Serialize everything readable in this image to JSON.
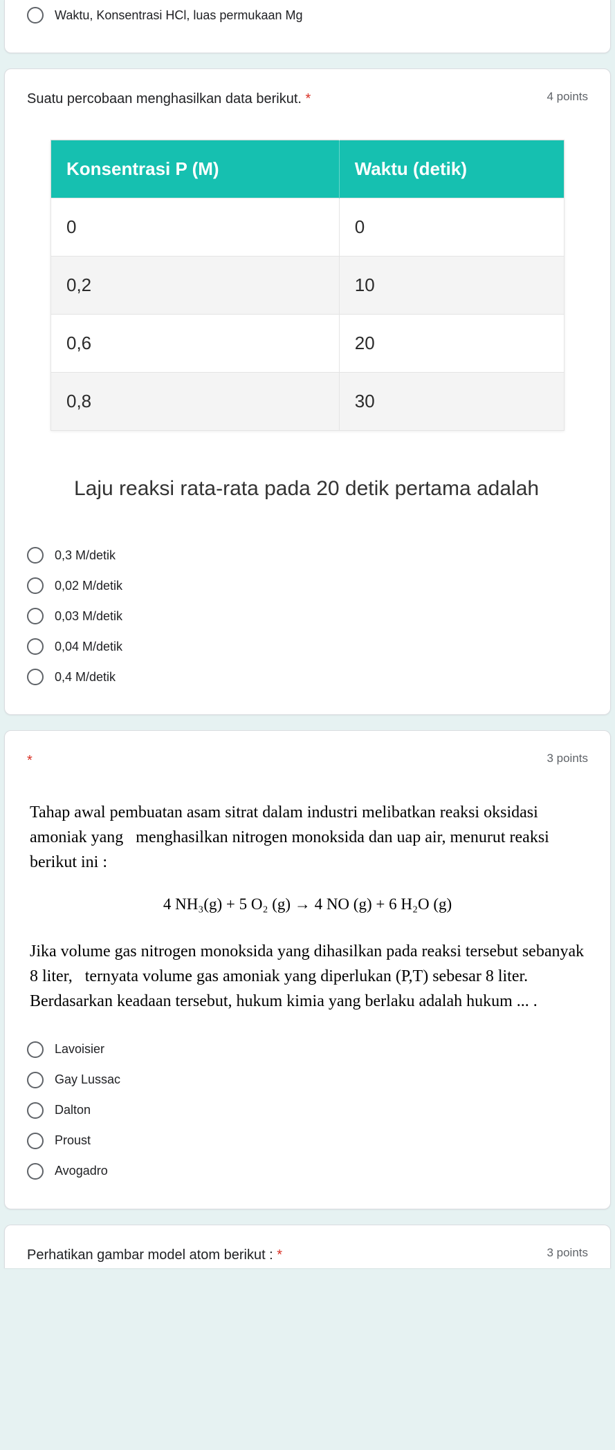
{
  "q1": {
    "opt_last": "Waktu, Konsentrasi HCl, luas permukaan Mg"
  },
  "q2": {
    "title": "Suatu percobaan menghasilkan data berikut.",
    "points": "4 points",
    "th1": "Konsentrasi P (M)",
    "th2": "Waktu (detik)",
    "rows": [
      {
        "c1": "0",
        "c2": "0"
      },
      {
        "c1": "0,2",
        "c2": "10"
      },
      {
        "c1": "0,6",
        "c2": "20"
      },
      {
        "c1": "0,8",
        "c2": "30"
      }
    ],
    "caption": "Laju reaksi rata-rata pada 20 detik pertama adalah",
    "opts": [
      "0,3 M/detik",
      "0,02 M/detik",
      "0,03 M/detik",
      "0,04 M/detik",
      "0,4 M/detik"
    ]
  },
  "q3": {
    "points": "3 points",
    "p1": "Tahap awal pembuatan asam sitrat dalam industri melibatkan reaksi oksidasi amoniak yang   menghasilkan nitrogen monoksida dan uap air, menurut reaksi berikut ini :",
    "eq": "4 NH₃(g)  + 5 O₂ (g)  →  4 NO (g)  +  6 H₂O (g)",
    "p2": " Jika volume gas nitrogen monoksida yang dihasilkan pada reaksi tersebut sebanyak 8 liter,   ternyata volume gas amoniak yang diperlukan (P,T) sebesar 8 liter. Berdasarkan keadaan tersebut, hukum kimia yang berlaku adalah hukum ... .",
    "opts": [
      "Lavoisier",
      "Gay Lussac",
      "Dalton",
      "Proust",
      "Avogadro"
    ]
  },
  "q4": {
    "title": "Perhatikan gambar model atom berikut :",
    "points": "3 points"
  },
  "chart_data": {
    "type": "table",
    "title": "Konsentrasi P (M) vs Waktu (detik)",
    "columns": [
      "Konsentrasi P (M)",
      "Waktu (detik)"
    ],
    "rows": [
      [
        0,
        0
      ],
      [
        0.2,
        10
      ],
      [
        0.6,
        20
      ],
      [
        0.8,
        30
      ]
    ]
  }
}
